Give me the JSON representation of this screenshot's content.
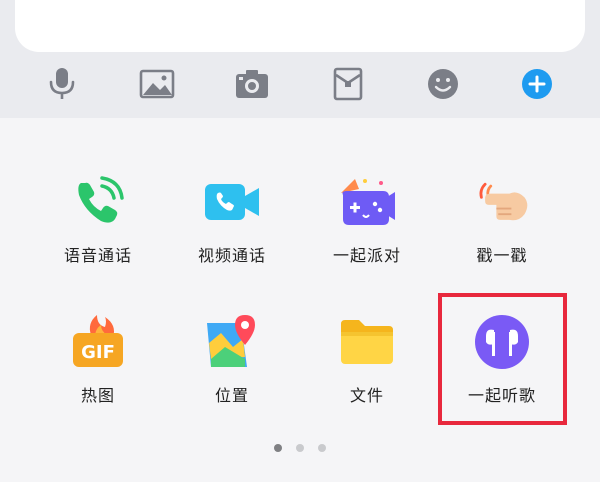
{
  "toolbar": {
    "icons": [
      "microphone-icon",
      "image-icon",
      "camera-icon",
      "red-packet-icon",
      "emoji-icon",
      "plus-icon"
    ],
    "accent_color": "#1e9bf0",
    "icon_color": "#7b7e87"
  },
  "grid": {
    "items": [
      {
        "label": "语音通话",
        "icon": "voice-call-icon"
      },
      {
        "label": "视频通话",
        "icon": "video-call-icon"
      },
      {
        "label": "一起派对",
        "icon": "party-icon"
      },
      {
        "label": "戳一戳",
        "icon": "poke-icon"
      },
      {
        "label": "热图",
        "icon": "hot-gif-icon"
      },
      {
        "label": "位置",
        "icon": "location-icon"
      },
      {
        "label": "文件",
        "icon": "folder-icon"
      },
      {
        "label": "一起听歌",
        "icon": "listen-music-icon"
      }
    ],
    "highlight_color": "#e8283d"
  },
  "pagination": {
    "pages": 3,
    "current": 1
  }
}
